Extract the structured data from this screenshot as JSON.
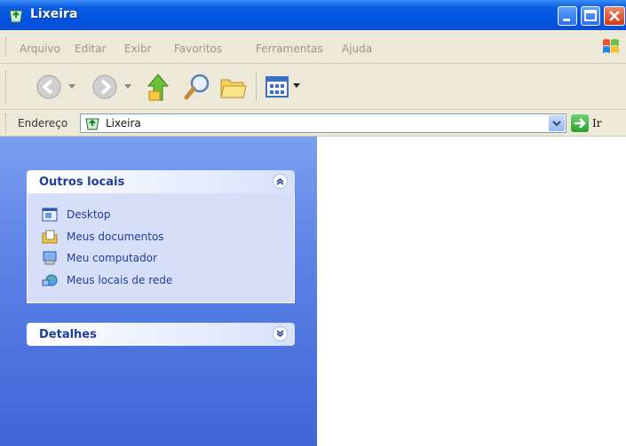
{
  "window": {
    "title": "Lixeira"
  },
  "menu": [
    "Arquivo",
    "Editar",
    "Exibr",
    "Favoritos",
    "Ferramentas",
    "Ajuda"
  ],
  "address": {
    "label": "Endereço",
    "value": "Lixeira",
    "go_label": "Ir"
  },
  "panels": {
    "outros_locais": {
      "title": "Outros locais",
      "items": [
        {
          "label": "Desktop",
          "icon": "desktop-icon"
        },
        {
          "label": "Meus documentos",
          "icon": "my-documents-icon"
        },
        {
          "label": "Meu computador",
          "icon": "my-computer-icon"
        },
        {
          "label": "Meus locais de rede",
          "icon": "network-places-icon"
        }
      ]
    },
    "detalhes": {
      "title": "Detalhes"
    }
  },
  "colors": {
    "titlebar": "#0053e0",
    "sidebar": "#5b82e6",
    "panel_text": "#1f3e9c",
    "close_button": "#d33a14"
  }
}
